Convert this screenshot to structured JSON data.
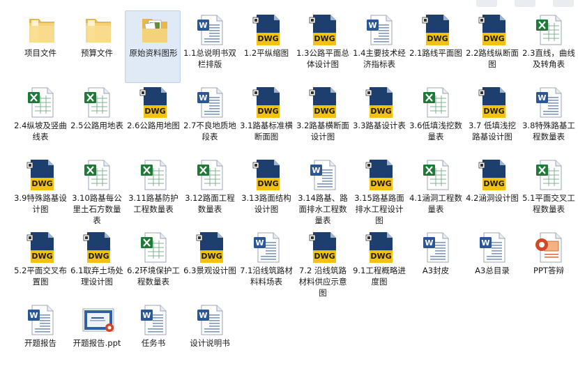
{
  "items": [
    {
      "label": "项目文件",
      "icon": "folder-icon",
      "type": "folder"
    },
    {
      "label": "预算文件",
      "icon": "folder-icon",
      "type": "folder"
    },
    {
      "label": "原始资料图形",
      "icon": "folder-icon",
      "type": "folder-images",
      "selected": true
    },
    {
      "label": "1.1总说明书双栏排版",
      "icon": "word-document-icon",
      "type": "word"
    },
    {
      "label": "1.2平纵缩图",
      "icon": "dwg-file-icon",
      "type": "dwg"
    },
    {
      "label": "1.3公路平面总体设计图",
      "icon": "dwg-file-icon",
      "type": "dwg"
    },
    {
      "label": "1.4主要技术经济指标表",
      "icon": "word-document-icon",
      "type": "word"
    },
    {
      "label": "2.1路线平面图",
      "icon": "dwg-file-icon",
      "type": "dwg"
    },
    {
      "label": "2.2路线纵断面图",
      "icon": "dwg-file-icon",
      "type": "dwg"
    },
    {
      "label": "2.3直线，曲线及转角表",
      "icon": "excel-spreadsheet-icon",
      "type": "excel"
    },
    {
      "label": "2.4纵坡及竖曲线表",
      "icon": "excel-spreadsheet-icon",
      "type": "excel"
    },
    {
      "label": "2.5公路用地表",
      "icon": "excel-spreadsheet-icon",
      "type": "excel"
    },
    {
      "label": "2.6公路用地图",
      "icon": "dwg-file-icon",
      "type": "dwg"
    },
    {
      "label": "2.7不良地质地段表",
      "icon": "word-document-icon",
      "type": "word"
    },
    {
      "label": "3.1路基标准横断面图",
      "icon": "dwg-file-icon",
      "type": "dwg"
    },
    {
      "label": "3.2路基横断面设计图",
      "icon": "dwg-file-icon",
      "type": "dwg"
    },
    {
      "label": "3.3路基设计表",
      "icon": "dwg-file-icon",
      "type": "dwg"
    },
    {
      "label": "3.6低填浅挖数量表",
      "icon": "excel-spreadsheet-icon",
      "type": "excel"
    },
    {
      "label": "3.7 低填浅挖路基设计图",
      "icon": "dwg-file-icon",
      "type": "dwg"
    },
    {
      "label": "3.8特殊路基工程数量表",
      "icon": "word-document-icon",
      "type": "word"
    },
    {
      "label": "3.9特殊路基设计图",
      "icon": "dwg-file-icon",
      "type": "dwg"
    },
    {
      "label": "3.10路基每公里土石方数量表",
      "icon": "excel-spreadsheet-icon",
      "type": "excel"
    },
    {
      "label": "3.11路基防护工程数量表",
      "icon": "excel-spreadsheet-icon",
      "type": "excel"
    },
    {
      "label": "3.12路面工程数量表",
      "icon": "excel-spreadsheet-icon",
      "type": "excel"
    },
    {
      "label": "3.13路面结构设计图",
      "icon": "dwg-file-icon",
      "type": "dwg"
    },
    {
      "label": "3.14路基、路面排水工程数量表",
      "icon": "word-document-icon",
      "type": "word"
    },
    {
      "label": "3.15路基路面排水工程设计图",
      "icon": "dwg-file-icon",
      "type": "dwg"
    },
    {
      "label": "4.1涵洞工程数量表",
      "icon": "excel-spreadsheet-icon",
      "type": "excel"
    },
    {
      "label": "4.2涵洞设计图",
      "icon": "dwg-file-icon",
      "type": "dwg"
    },
    {
      "label": "5.1平面交叉工程数量表",
      "icon": "excel-spreadsheet-icon",
      "type": "excel"
    },
    {
      "label": "5.2平面交叉布置图",
      "icon": "dwg-file-icon",
      "type": "dwg"
    },
    {
      "label": "6.1取弃土场处理设计图",
      "icon": "dwg-file-icon",
      "type": "dwg"
    },
    {
      "label": "6.2环境保护工程数量表",
      "icon": "excel-spreadsheet-icon",
      "type": "excel"
    },
    {
      "label": "6.3景观设计图",
      "icon": "dwg-file-icon",
      "type": "dwg"
    },
    {
      "label": "7.1沿线筑路材料料场表",
      "icon": "word-document-icon",
      "type": "word"
    },
    {
      "label": "7.2 沿线筑路材料供应示意图",
      "icon": "dwg-file-icon",
      "type": "dwg"
    },
    {
      "label": "9.1工程概略进度图",
      "icon": "dwg-file-icon",
      "type": "dwg"
    },
    {
      "label": "A3封皮",
      "icon": "word-document-icon",
      "type": "word"
    },
    {
      "label": "A3总目录",
      "icon": "word-document-icon",
      "type": "word"
    },
    {
      "label": "PPT答辩",
      "icon": "powerpoint-icon",
      "type": "ppt"
    },
    {
      "label": "开题报告",
      "icon": "word-document-icon",
      "type": "word"
    },
    {
      "label": "开题报告.ppt",
      "icon": "ppt-thumbnail-icon",
      "type": "ppt-thumb"
    },
    {
      "label": "任务书",
      "icon": "word-document-icon",
      "type": "word"
    },
    {
      "label": "设计说明书",
      "icon": "word-document-icon",
      "type": "word"
    }
  ],
  "icon_text": {
    "dwg": "DWG",
    "word_badge": "W"
  },
  "colors": {
    "selection": "#dfeaf6",
    "dwg_dark": "#1c3f6e",
    "dwg_yellow": "#f2c20e",
    "word_blue": "#2b5797",
    "excel_green": "#1f7a3a",
    "ppt_orange": "#d24726",
    "folder": "#f3d27a"
  }
}
